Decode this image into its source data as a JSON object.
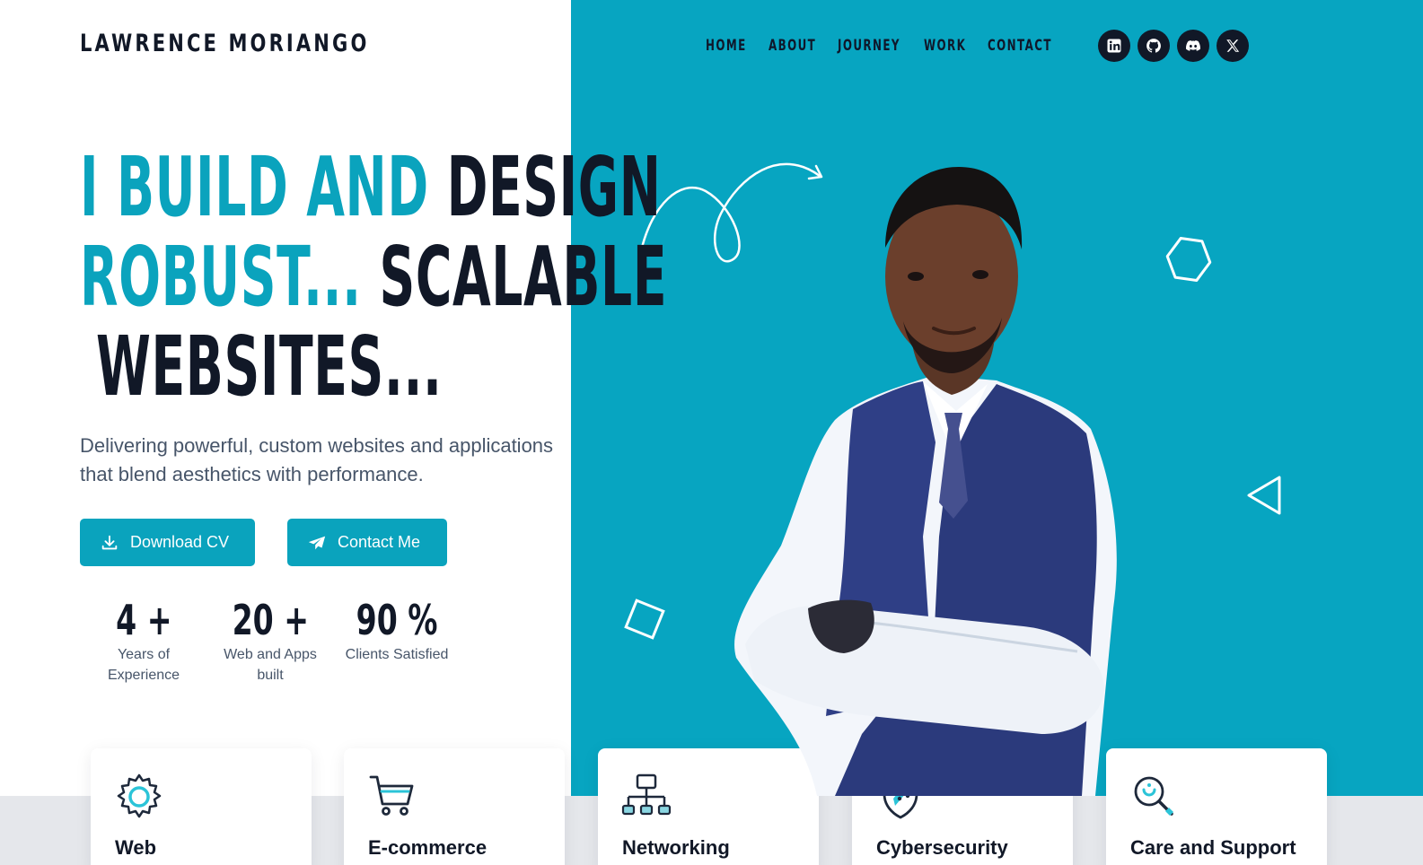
{
  "brand": {
    "name": "LAWRENCE MORIANGO"
  },
  "nav": {
    "items": [
      {
        "label": "HOME"
      },
      {
        "label": "ABOUT"
      },
      {
        "label": "JOURNEY"
      },
      {
        "label": "WORK"
      },
      {
        "label": "CONTACT"
      }
    ]
  },
  "social": [
    {
      "icon": "linkedin-icon"
    },
    {
      "icon": "github-icon"
    },
    {
      "icon": "discord-icon"
    },
    {
      "icon": "x-icon"
    }
  ],
  "hero": {
    "line1_teal": "I BUILD AND",
    "line1_dark": "DESIGN",
    "line2_teal": "ROBUST...",
    "line2_dark": "SCALABLE",
    "line3_dark": "WEBSITES...",
    "subtitle": "Delivering powerful, custom websites and applications that blend aesthetics with performance."
  },
  "buttons": {
    "download_cv": "Download CV",
    "contact_me": "Contact Me"
  },
  "stats": [
    {
      "value": "4 +",
      "label": "Years of Experience"
    },
    {
      "value": "20 +",
      "label": "Web and Apps built"
    },
    {
      "value": "90 %",
      "label": "Clients Satisfied"
    }
  ],
  "services": [
    {
      "title": "Web",
      "icon": "gear-icon"
    },
    {
      "title": "E-commerce",
      "icon": "cart-icon"
    },
    {
      "title": "Networking",
      "icon": "network-icon"
    },
    {
      "title": "Cybersecurity",
      "icon": "shield-icon"
    },
    {
      "title": "Care and Support",
      "icon": "search-support-icon"
    }
  ],
  "colors": {
    "accent": "#0aa3bd",
    "panel": "#07a5c1",
    "text_dark": "#111827",
    "text_muted": "#475569"
  }
}
